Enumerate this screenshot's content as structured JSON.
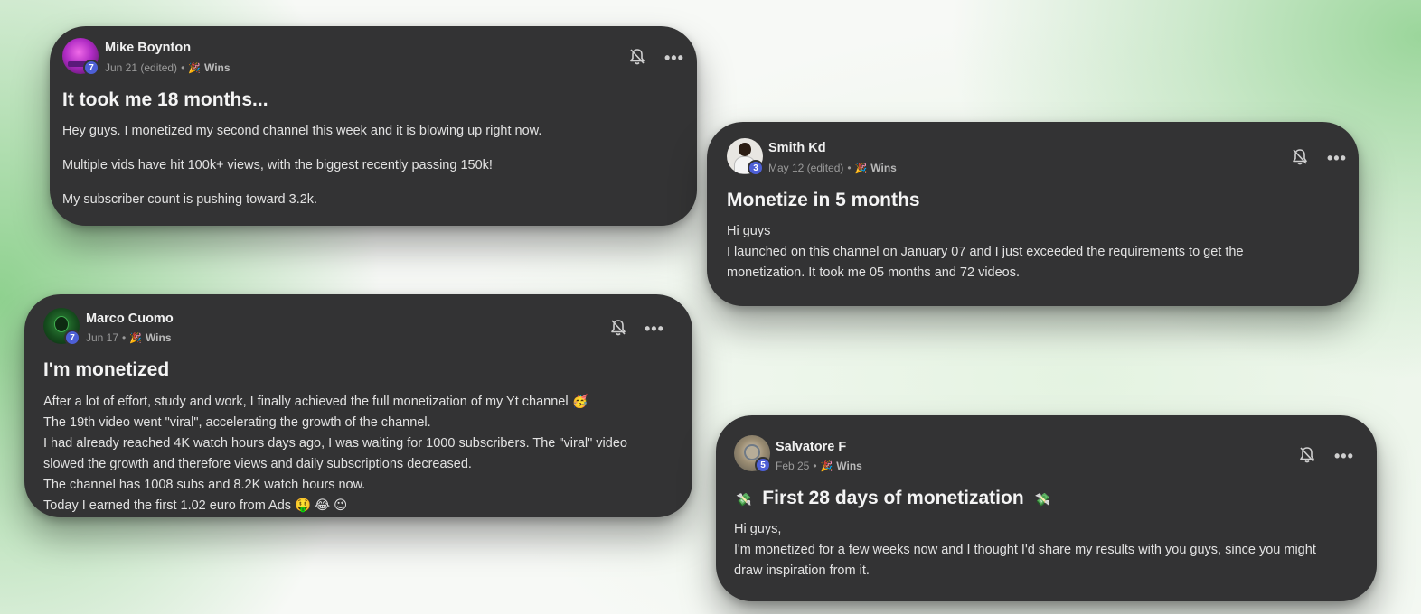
{
  "posts": [
    {
      "author": "Mike Boynton",
      "level": "7",
      "date": "Jun 21 (edited)",
      "separator": "•",
      "category": "Wins",
      "title": "It took me 18 months...",
      "paragraphs": [
        "Hey guys. I monetized my second channel this week and it is blowing up right now.",
        "Multiple vids have hit 100k+ views, with the biggest recently passing 150k!",
        "My subscriber count is pushing toward 3.2k."
      ]
    },
    {
      "author": "Smith Kd",
      "level": "3",
      "date": "May 12 (edited)",
      "separator": "•",
      "category": "Wins",
      "title": "Monetize in 5 months",
      "lines": [
        "Hi guys",
        "I launched on this channel on January 07 and I just exceeded the requirements to get the",
        "monetization. It took me 05 months and 72 videos."
      ]
    },
    {
      "author": "Marco Cuomo",
      "level": "7",
      "date": "Jun 17",
      "separator": "•",
      "category": "Wins",
      "title": "I'm monetized",
      "lines": [
        "After a lot of effort, study and work, I finally achieved the full monetization of my Yt channel 🥳",
        "The 19th video went \"viral\", accelerating the growth of the channel.",
        "I had already reached 4K watch hours days ago, I was waiting for 1000 subscribers. The \"viral\" video",
        "slowed the growth and therefore views and daily subscriptions decreased.",
        "The channel has 1008 subs and 8.2K watch hours now.",
        "Today I earned the first 1.02 euro from Ads 🤑 😂 😉"
      ]
    },
    {
      "author": "Salvatore F",
      "level": "5",
      "date": "Feb 25",
      "separator": "•",
      "category": "Wins",
      "title": "First 28 days of monetization",
      "title_emoji": "💸",
      "lines": [
        "Hi guys,",
        "I'm monetized for a few weeks now and I thought I'd share my results with you guys, since you might",
        "draw inspiration from it."
      ]
    }
  ],
  "icons": {
    "bell": "bell-off-icon",
    "more": "more-icon",
    "category": "party-popper-icon"
  },
  "symbols": {
    "more": "•••",
    "party": "🎉"
  },
  "colors": {
    "card": "#333334",
    "badge": "#4d5fd6",
    "background_accent": "#8fd18f"
  }
}
